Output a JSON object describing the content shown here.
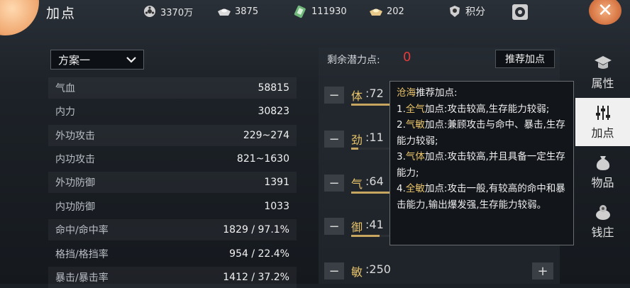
{
  "header": {
    "title": "加点",
    "resources": [
      {
        "icon": "film-reel-icon",
        "value": "3370万"
      },
      {
        "icon": "silver-ingot-icon",
        "value": "3875"
      },
      {
        "icon": "jade-token-icon",
        "value": "111930"
      },
      {
        "icon": "gold-ingot-icon",
        "value": "202"
      },
      {
        "icon": "shield-badge-icon",
        "value": "积分"
      }
    ]
  },
  "plan": {
    "selected": "方案一"
  },
  "stats": [
    {
      "label": "气血",
      "value": "58815"
    },
    {
      "label": "内力",
      "value": "30823"
    },
    {
      "label": "外功攻击",
      "value": "229~274"
    },
    {
      "label": "内功攻击",
      "value": "821~1630"
    },
    {
      "label": "外功防御",
      "value": "1391"
    },
    {
      "label": "内功防御",
      "value": "1033"
    },
    {
      "label": "命中/命中率",
      "value": "1829 / 97.1%"
    },
    {
      "label": "格挡/格挡率",
      "value": "954 / 22.4%"
    },
    {
      "label": "暴击/暴击率",
      "value": "1412 / 37.2%"
    }
  ],
  "points": {
    "remaining_label": "剩余潜力点:",
    "remaining_value": "0",
    "recommend_button": "推荐加点"
  },
  "attributes": [
    {
      "name": "体",
      "value": ":72",
      "level": 0.29
    },
    {
      "name": "劲",
      "value": ":11",
      "level": 0.04
    },
    {
      "name": "气",
      "value": ":64",
      "level": 0.26
    },
    {
      "name": "御",
      "value": ":41",
      "level": 0.16
    },
    {
      "name": "敏",
      "value": ":250",
      "level": 1.0
    }
  ],
  "tooltip": {
    "title_hl": "沧海",
    "title_rest": "推荐加点:",
    "lines": [
      {
        "prefix": "1.",
        "hl": "全气",
        "text": "加点:攻击较高,生存能力较弱;"
      },
      {
        "prefix": "2.",
        "hl": "气敏",
        "text": "加点:兼顾攻击与命中、暴击,生存能力较弱;"
      },
      {
        "prefix": "3.",
        "hl": "气体",
        "text": "加点:攻击较高,并且具备一定生存能力;"
      },
      {
        "prefix": "4.",
        "hl": "全敏",
        "text": "加点:攻击一般,有较高的命中和暴击能力,输出爆发强,生存能力较弱。"
      }
    ]
  },
  "tabs": [
    {
      "label": "属性",
      "icon": "scholar-hat-icon"
    },
    {
      "label": "加点",
      "icon": "sliders-icon"
    },
    {
      "label": "物品",
      "icon": "money-bag-icon"
    },
    {
      "label": "钱庄",
      "icon": "coin-pouch-icon"
    }
  ],
  "colors": {
    "accent": "#e9c46a",
    "warning": "#e23b3b",
    "active_tab": "#f0f0f0"
  }
}
